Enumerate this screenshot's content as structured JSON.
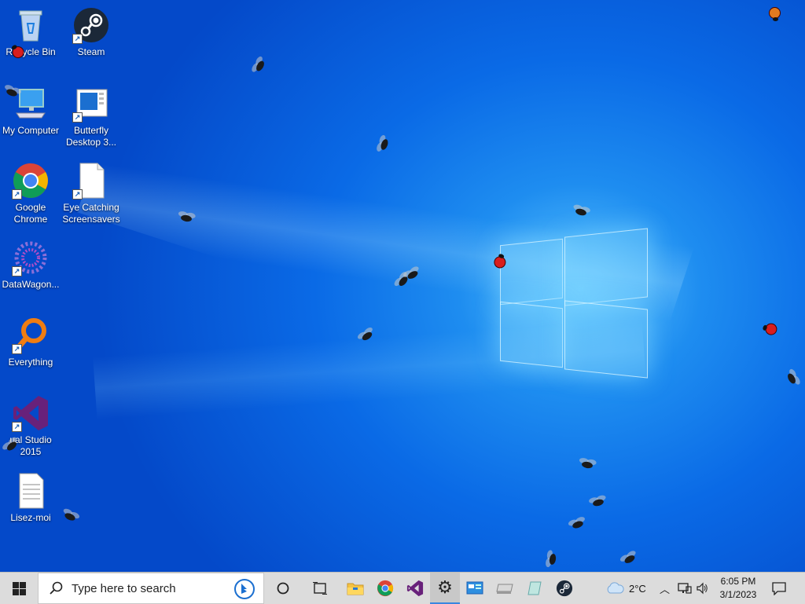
{
  "desktop": {
    "icons": [
      {
        "label": "Recycle Bin",
        "icon": "recycle-bin-icon"
      },
      {
        "label": "Steam",
        "icon": "steam-icon"
      },
      {
        "label": "My Computer",
        "icon": "computer-icon"
      },
      {
        "label": "Butterfly Desktop 3...",
        "icon": "butterfly-desktop-icon"
      },
      {
        "label": "Google Chrome",
        "icon": "chrome-icon"
      },
      {
        "label": "Eye Catching Screensavers",
        "icon": "document-icon"
      },
      {
        "label": "DataWagon...",
        "icon": "datawagon-icon"
      },
      {
        "label": "Everything",
        "icon": "everything-search-icon"
      },
      {
        "label": "ual Studio 2015",
        "icon": "visual-studio-icon"
      },
      {
        "label": "Lisez-moi",
        "icon": "text-document-icon"
      }
    ]
  },
  "taskbar": {
    "search_placeholder": "Type here to search",
    "pinned": [
      "cortana-icon",
      "task-view-icon",
      "file-explorer-icon",
      "chrome-icon",
      "visual-studio-icon",
      "settings-gear-icon",
      "control-panel-icon",
      "drive-icon",
      "app-icon",
      "steam-icon"
    ],
    "weather": {
      "temp": "2°C",
      "icon": "cloud-icon"
    },
    "time": "6:05 PM",
    "date": "3/1/2023"
  },
  "colors": {
    "accent": "#0a6ae6",
    "taskbar": "#dcdcdc",
    "ladybug": "#d81e1e"
  }
}
